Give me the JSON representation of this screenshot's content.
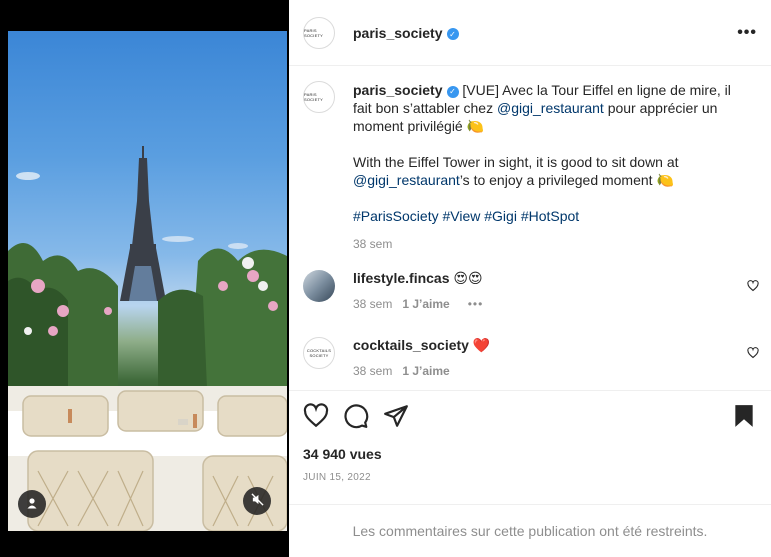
{
  "post": {
    "author": "paris_society",
    "author_avatar_text": "PARIS SOCIETY",
    "verified_mark": "✓",
    "more_label": "•••"
  },
  "caption": {
    "author": "paris_society",
    "text_fr_prefix": " [VUE] Avec la Tour Eiffel en ligne de mire, il fait bon s’attabler chez ",
    "mention": "@gigi_restaurant",
    "text_fr_suffix": " pour apprécier un moment privilégié 🍋",
    "text_en_prefix": "With the Eiffel Tower in sight, it is good to sit down at ",
    "text_en_suffix": "’s to enjoy a privileged moment 🍋",
    "hashtags": "#ParisSociety #View #Gigi #HotSpot",
    "time": "38 sem"
  },
  "comments": [
    {
      "username": "lifestyle.fincas",
      "text": " 😍😍",
      "time": "38 sem",
      "likes": "1 J’aime",
      "more": "•••"
    },
    {
      "username": "cocktails_society",
      "text": " ❤️",
      "time": "38 sem",
      "likes": "1 J’aime",
      "avatar_text": "COCKTAILS SOCIETY"
    }
  ],
  "stats": {
    "views": "34 940 vues",
    "date": "JUIN 15, 2022"
  },
  "restricted_notice": "Les commentaires sur cette publication ont été restreints.",
  "icons": {
    "like": "heart-icon",
    "comment": "comment-bubble-icon",
    "share": "paper-plane-icon",
    "save": "bookmark-icon",
    "user_tag": "user-icon",
    "mute": "speaker-muted-icon"
  },
  "colors": {
    "link": "#00376b",
    "verified": "#3897f0",
    "muted_text": "#8e8e8e",
    "heart_red": "#ed4956"
  }
}
